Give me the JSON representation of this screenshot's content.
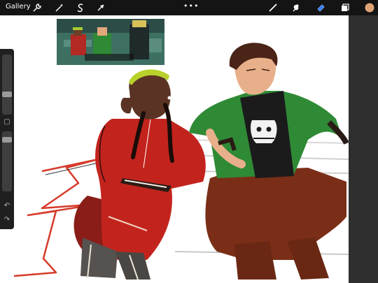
{
  "app": {
    "gallery_label": "Gallery",
    "more_label": "•••"
  },
  "toolbar_left": [
    {
      "icon": "wrench-icon"
    },
    {
      "icon": "magic-wand-icon"
    },
    {
      "icon": "selection-s-icon"
    },
    {
      "icon": "transform-arrow-icon"
    }
  ],
  "toolbar_right": [
    {
      "icon": "brush-icon"
    },
    {
      "icon": "smudge-icon"
    },
    {
      "icon": "eraser-icon",
      "active": true
    },
    {
      "icon": "layers-icon"
    },
    {
      "icon": "color-swatch-icon",
      "color": "#e0a274"
    }
  ],
  "sidebar": {
    "brush_size": 0.52,
    "opacity": 0.42,
    "square_label": "▢",
    "undo_label": "↶",
    "redo_label": "↷"
  },
  "colors": {
    "accent_blue": "#2f7cf6",
    "red_jacket": "#c2241d",
    "green_jacket": "#2f8a36",
    "brown_pants": "#7a2e17",
    "skin_dark": "#5a3324",
    "skin_light": "#e8b08a"
  }
}
